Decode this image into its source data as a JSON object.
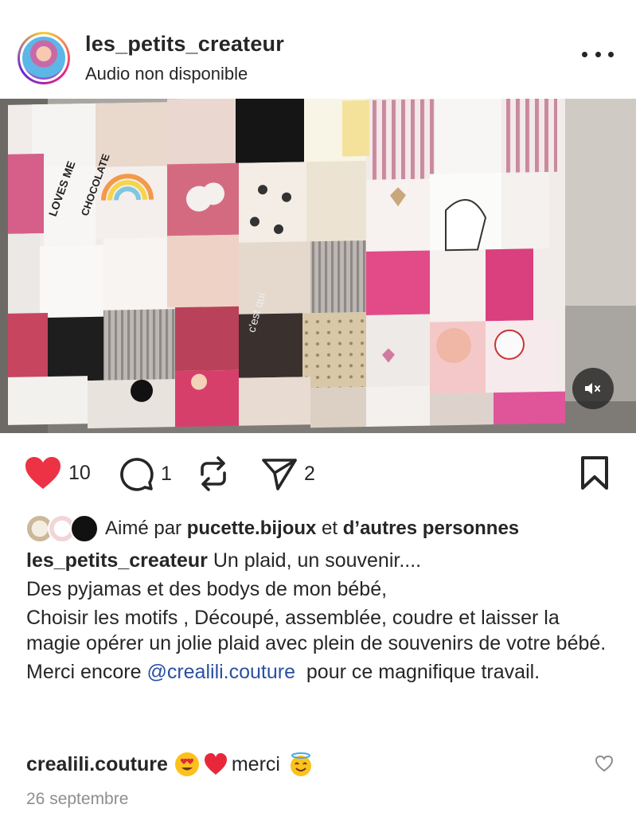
{
  "post": {
    "author": "les_petits_createur",
    "subtitle": "Audio non disponible",
    "more_icon": "more-horizontal-icon"
  },
  "actions": {
    "like_count": "10",
    "comment_count": "1",
    "repost_count": "",
    "share_count": "2",
    "like_color": "#ed3245"
  },
  "likes": {
    "prefix": "Aimé par ",
    "user": "pucette.bijoux",
    "middle": " et ",
    "others": "d’autres personnes"
  },
  "caption": {
    "user": "les_petits_createur",
    "line1": " Un plaid, un souvenir....",
    "line2": "Des pyjamas et des bodys de mon bébé,",
    "line3": "Choisir les motifs , Découpé, assemblée, coudre et laisser la magie opérer un jolie plaid avec plein de souvenirs de votre bébé.",
    "line4_prefix": "Merci encore ",
    "mention": "@crealili.couture",
    "line4_suffix": "  pour ce magnifique travail."
  },
  "comment": {
    "user": "crealili.couture",
    "text": "merci"
  },
  "date": "26 septembre",
  "colors": {
    "mention": "#2a50a3",
    "muted": "#8e8e8e"
  }
}
